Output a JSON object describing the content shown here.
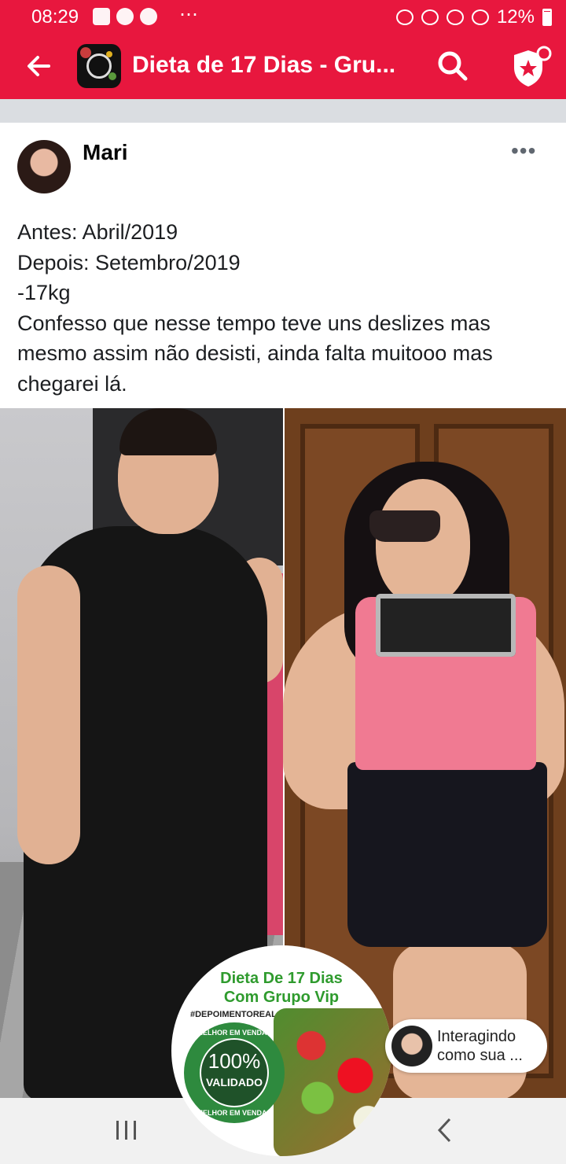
{
  "status_bar": {
    "time": "08:29",
    "battery": "12%"
  },
  "app_bar": {
    "title": "Dieta de 17 Dias - Gru..."
  },
  "post": {
    "author": "Mari",
    "lines": [
      "Antes: Abril/2019",
      "Depois: Setembro/2019",
      "-17kg",
      "Confesso que nesse tempo teve uns deslizes mas",
      "mesmo assim não desisti, ainda falta muitooo mas",
      "chegarei lá."
    ]
  },
  "promo": {
    "title_line1": "Dieta De 17 Dias",
    "title_line2": "Com Grupo Vip",
    "hashtag": "#DEPOIMENTOREAL",
    "seal_percent": "100%",
    "seal_label": "VALIDADO",
    "seal_ring": "MELHOR EM VENDAS"
  },
  "chat_head": {
    "line1": "Interagindo",
    "line2": "como sua ..."
  },
  "colors": {
    "brand": "#e8173e",
    "divider": "#dadde1"
  }
}
